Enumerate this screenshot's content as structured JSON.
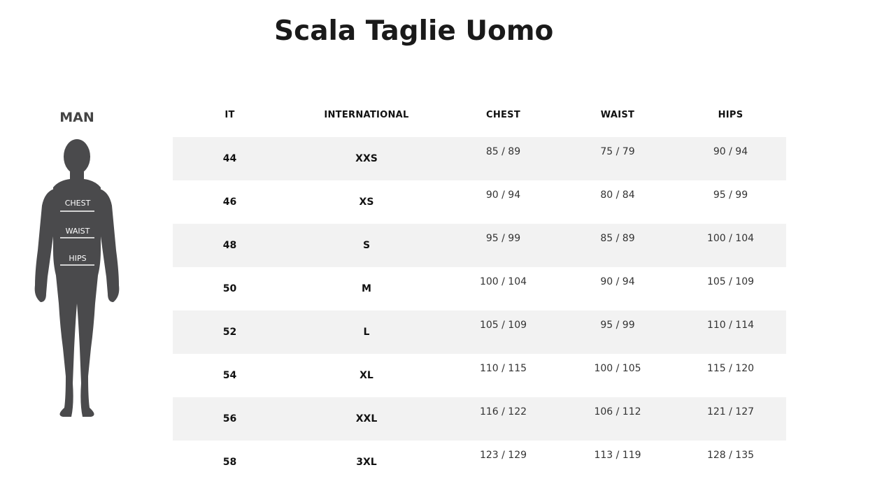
{
  "page": {
    "title": "Scala Taglie Uomo"
  },
  "figure": {
    "heading": "MAN",
    "labels": {
      "chest": "CHEST",
      "waist": "WAIST",
      "hips": "HIPS"
    },
    "silhouette_color": "#4a4a4c"
  },
  "table": {
    "headers": {
      "it": "IT",
      "international": "INTERNATIONAL",
      "chest": "CHEST",
      "waist": "WAIST",
      "hips": "HIPS"
    },
    "rows": [
      {
        "it": "44",
        "international": "XXS",
        "chest": "85 / 89",
        "waist": "75 / 79",
        "hips": "90 / 94"
      },
      {
        "it": "46",
        "international": "XS",
        "chest": "90 / 94",
        "waist": "80 / 84",
        "hips": "95 / 99"
      },
      {
        "it": "48",
        "international": "S",
        "chest": "95 / 99",
        "waist": "85 / 89",
        "hips": "100 / 104"
      },
      {
        "it": "50",
        "international": "M",
        "chest": "100 / 104",
        "waist": "90 / 94",
        "hips": "105 / 109"
      },
      {
        "it": "52",
        "international": "L",
        "chest": "105 / 109",
        "waist": "95 / 99",
        "hips": "110 / 114"
      },
      {
        "it": "54",
        "international": "XL",
        "chest": "110 / 115",
        "waist": "100 / 105",
        "hips": "115 / 120"
      },
      {
        "it": "56",
        "international": "XXL",
        "chest": "116 / 122",
        "waist": "106 / 112",
        "hips": "121 / 127"
      },
      {
        "it": "58",
        "international": "3XL",
        "chest": "123 / 129",
        "waist": "113 / 119",
        "hips": "128 / 135"
      }
    ],
    "stripe_color": "#f2f2f2"
  }
}
